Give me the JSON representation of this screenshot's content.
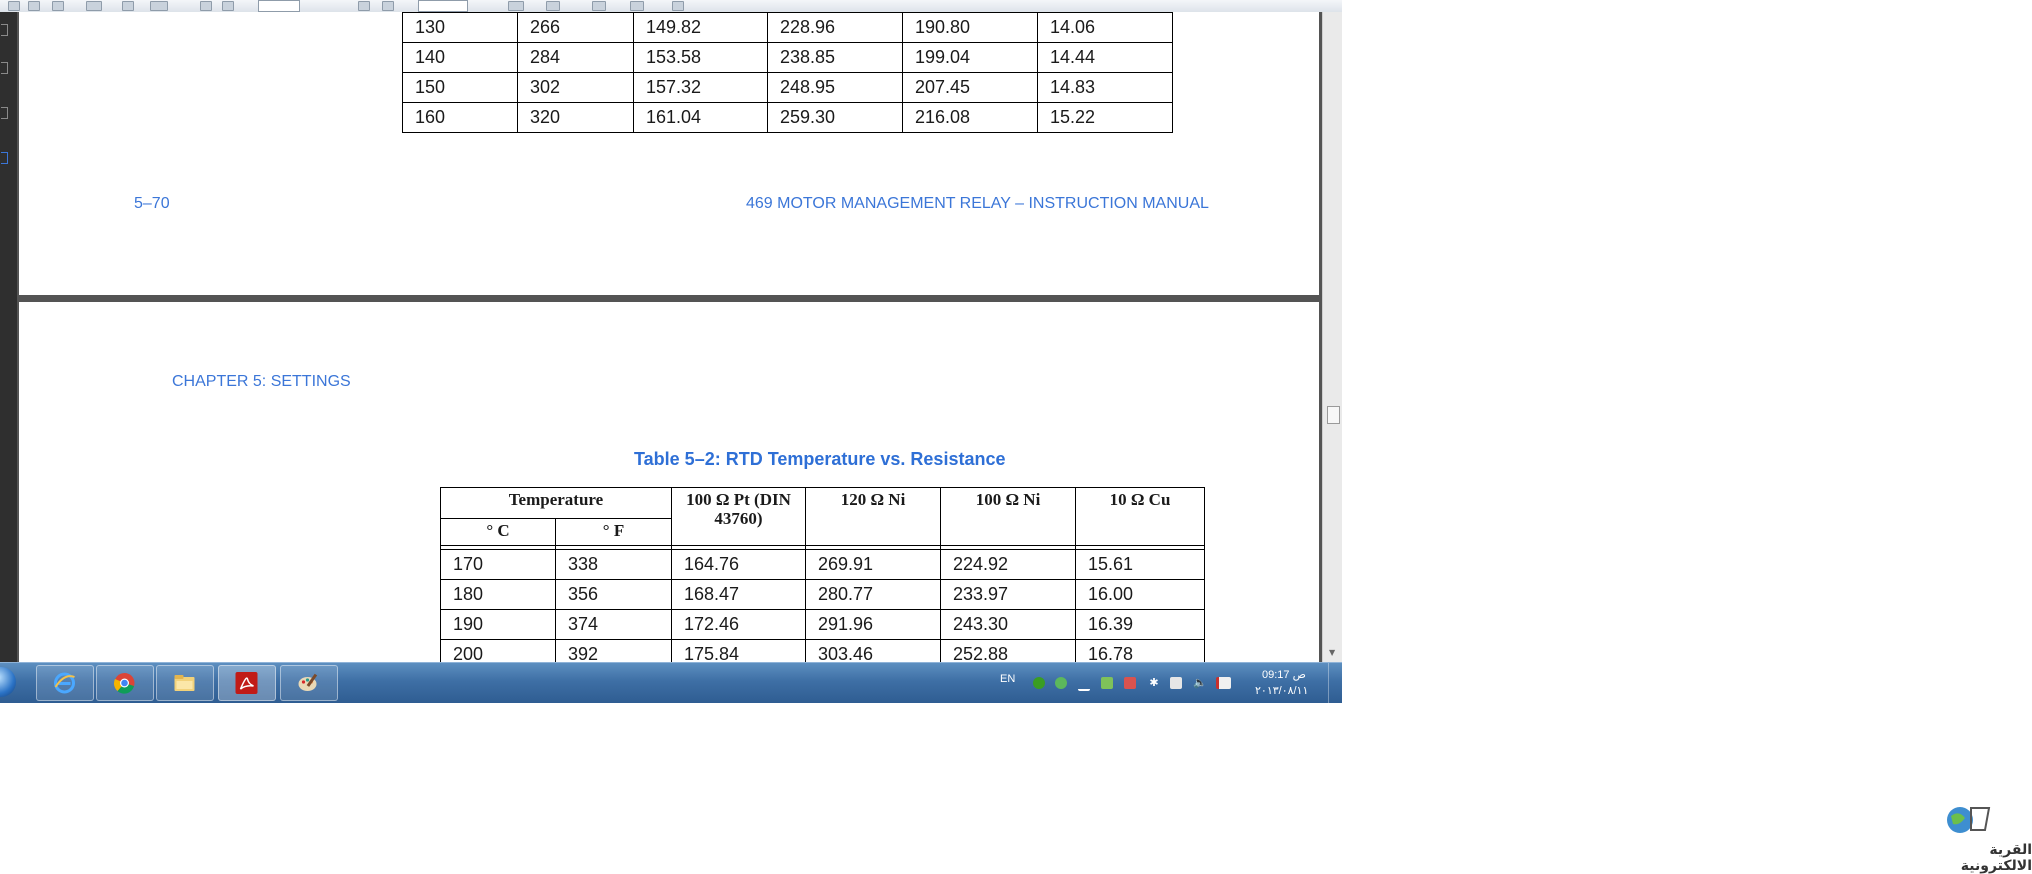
{
  "page1": {
    "rows": [
      [
        "130",
        "266",
        "149.82",
        "228.96",
        "190.80",
        "14.06"
      ],
      [
        "140",
        "284",
        "153.58",
        "238.85",
        "199.04",
        "14.44"
      ],
      [
        "150",
        "302",
        "157.32",
        "248.95",
        "207.45",
        "14.83"
      ],
      [
        "160",
        "320",
        "161.04",
        "259.30",
        "216.08",
        "15.22"
      ]
    ],
    "footer_page_number": "5–70",
    "footer_title": "469 MOTOR MANAGEMENT RELAY – INSTRUCTION MANUAL"
  },
  "page2": {
    "chapter_header": "CHAPTER 5: SETTINGS",
    "table_caption": "Table 5–2: RTD Temperature vs. Resistance",
    "headers": {
      "temperature": "Temperature",
      "celsius": "° C",
      "fahrenheit": "° F",
      "pt100": "100 Ω Pt (DIN 43760)",
      "ni120": "120 Ω Ni",
      "ni100": "100 Ω Ni",
      "cu10": "10 Ω Cu"
    },
    "rows": [
      [
        "170",
        "338",
        "164.76",
        "269.91",
        "224.92",
        "15.61"
      ],
      [
        "180",
        "356",
        "168.47",
        "280.77",
        "233.97",
        "16.00"
      ],
      [
        "190",
        "374",
        "172.46",
        "291.96",
        "243.30",
        "16.39"
      ],
      [
        "200",
        "392",
        "175.84",
        "303.46",
        "252.88",
        "16.78"
      ]
    ]
  },
  "taskbar": {
    "apps": [
      "internet-explorer-icon",
      "chrome-icon",
      "file-explorer-icon",
      "adobe-reader-icon",
      "paint-icon"
    ],
    "language": "EN",
    "time": "ص 09:17",
    "date": "٢٠١٣/٠٨/١١"
  },
  "watermark": {
    "text": "القرية الالكترونية"
  },
  "colors": {
    "link_blue": "#3b76d8",
    "taskbar": "#3e6fa5",
    "doc_background": "#545454"
  }
}
